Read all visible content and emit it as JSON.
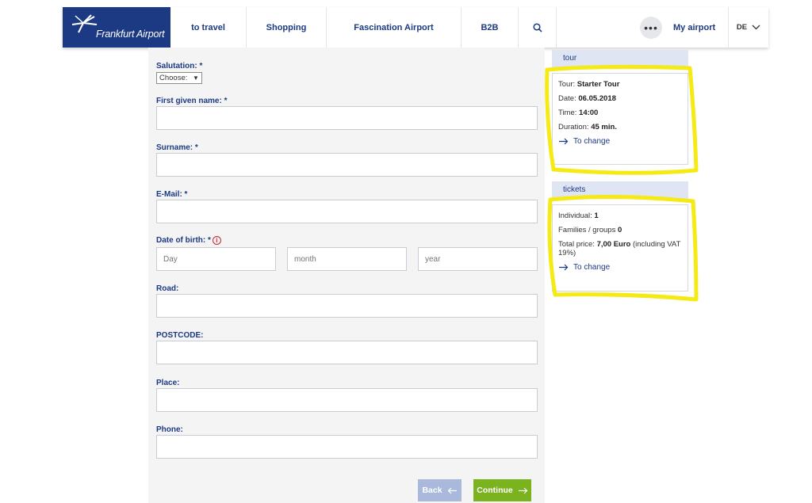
{
  "header": {
    "logo_text": "Frankfurt Airport",
    "nav": [
      "to travel",
      "Shopping",
      "Fascination Airport",
      "B2B"
    ],
    "search_icon": "search-icon",
    "more_icon": "more-dots-icon",
    "more_symbol": "•••",
    "my_airport": "My airport",
    "language": "DE"
  },
  "form": {
    "salutation_label": "Salutation: *",
    "salutation_value": "Choose:",
    "salutation_arrow": "▼",
    "first_name_label": "First given name: *",
    "surname_label": "Surname: *",
    "email_label": "E-Mail: *",
    "dob_label": "Date of birth: *",
    "dob_info": "i",
    "dob_day_placeholder": "Day",
    "dob_month_placeholder": "month",
    "dob_year_placeholder": "year",
    "road_label": "Road:",
    "postcode_label": "POSTCODE:",
    "place_label": "Place:",
    "phone_label": "Phone:",
    "back_label": "Back",
    "continue_label": "Continue"
  },
  "tour": {
    "heading": "tour",
    "tour_label": "Tour: ",
    "tour_value": "Starter Tour",
    "date_label": "Date: ",
    "date_value": "06.05.2018",
    "time_label": "Time: ",
    "time_value": "14:00",
    "duration_label": "Duration: ",
    "duration_value": "45 min.",
    "change_link": "To change"
  },
  "tickets": {
    "heading": "tickets",
    "individual_label": "Individual: ",
    "individual_value": "1",
    "families_label": "Families / groups ",
    "families_value": "0",
    "total_label": "Total price: ",
    "total_value": "7,00 Euro",
    "total_note": " (including VAT 19%)",
    "change_link": "To change"
  },
  "colors": {
    "brand_blue": "#1c3a83",
    "continue_green": "#7bb31f",
    "back_disabled": "#a9b9dc",
    "highlight_yellow": "#f5ea14"
  }
}
